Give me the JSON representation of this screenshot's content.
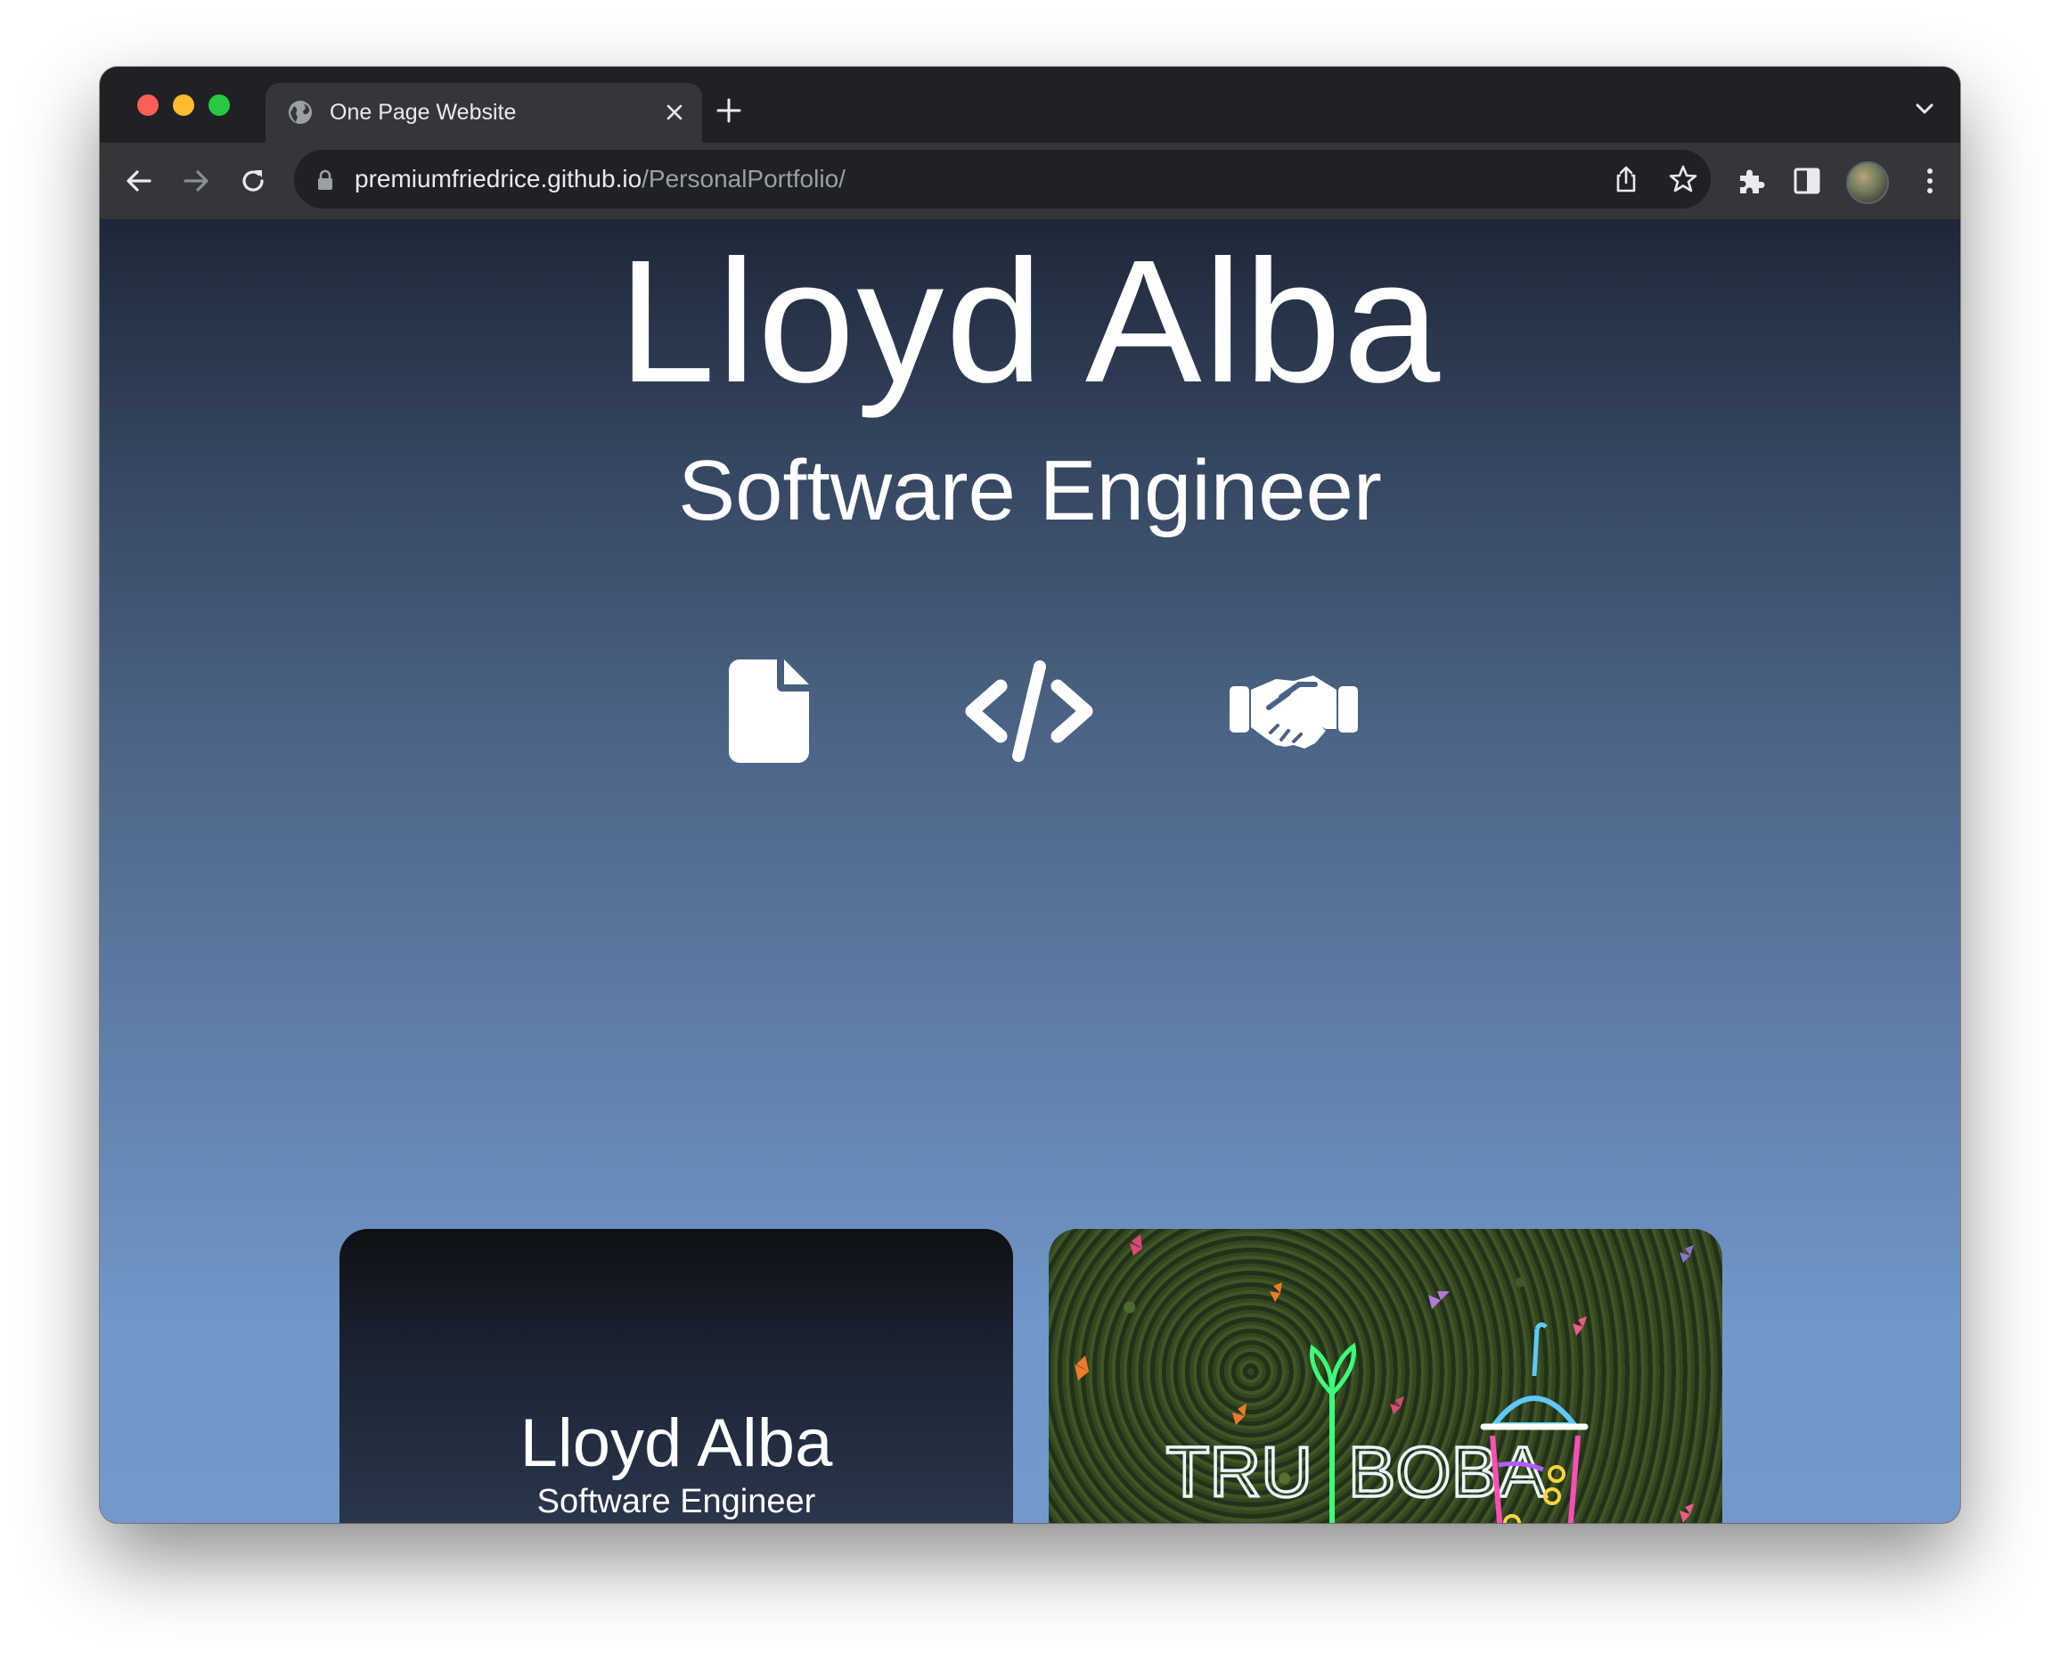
{
  "browser": {
    "tab": {
      "title": "One Page Website",
      "icon": "globe-icon"
    },
    "address_bar": {
      "host": "premiumfriedrice.github.io",
      "path": "/PersonalPortfolio/"
    }
  },
  "page": {
    "hero": {
      "name": "Lloyd Alba",
      "role": "Software Engineer",
      "links": [
        {
          "icon": "resume-file-icon"
        },
        {
          "icon": "code-icon"
        },
        {
          "icon": "handshake-icon"
        }
      ]
    },
    "cards": {
      "intro": {
        "name": "Lloyd Alba",
        "role": "Software Engineer"
      },
      "project": {
        "sign_text": "TRU BOBA CAFE"
      }
    }
  },
  "colors": {
    "page_gradient_top": "#1e2738",
    "page_gradient_bottom": "#7399cc",
    "text": "#ffffff",
    "neon_green": "#3dff7a",
    "neon_pink": "#ff4fb6",
    "neon_blue": "#5fc8ff"
  }
}
